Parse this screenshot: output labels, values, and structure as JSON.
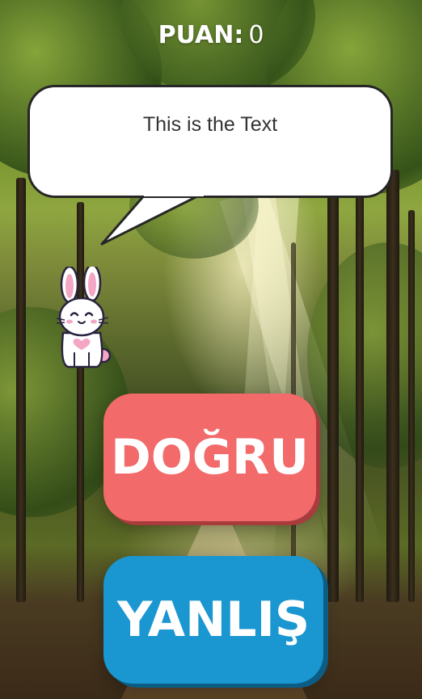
{
  "hud": {
    "score_label": "PUAN:",
    "score_value": "0"
  },
  "speech_bubble": {
    "text": "This is the Text"
  },
  "character": {
    "icon": "bunny-icon"
  },
  "buttons": {
    "true_label": "DOĞRU",
    "false_label": "YANLIŞ"
  },
  "colors": {
    "true_button": "#f26a6a",
    "false_button": "#1a96d0",
    "bubble_fill": "#ffffff",
    "bubble_border": "#262626"
  }
}
